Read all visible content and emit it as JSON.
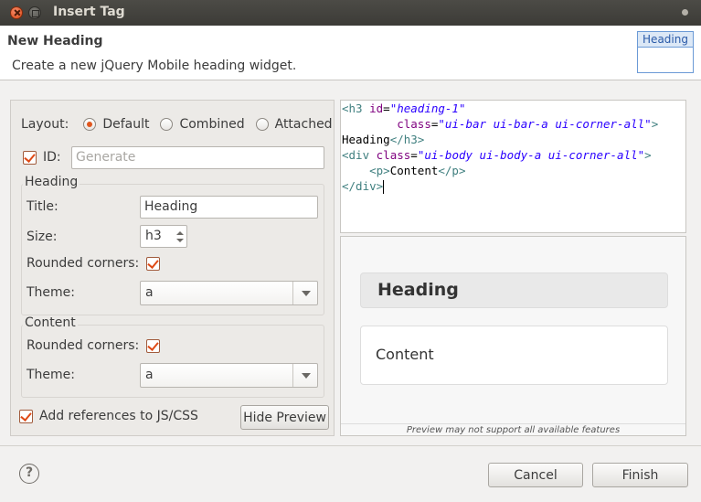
{
  "window": {
    "title": "Insert Tag"
  },
  "header": {
    "title": "New Heading",
    "description": "Create a new jQuery Mobile heading widget.",
    "badge": "Heading"
  },
  "form": {
    "layout_label": "Layout:",
    "layout_options": [
      "Default",
      "Combined",
      "Attached"
    ],
    "layout_selected": "Default",
    "id_label": "ID:",
    "id_checked": true,
    "id_placeholder": "Generate",
    "heading_group": {
      "label": "Heading",
      "title_label": "Title:",
      "title_value": "Heading",
      "size_label": "Size:",
      "size_value": "h3",
      "rounded_label": "Rounded corners:",
      "rounded_checked": true,
      "theme_label": "Theme:",
      "theme_value": "a"
    },
    "content_group": {
      "label": "Content",
      "rounded_label": "Rounded corners:",
      "rounded_checked": true,
      "theme_label": "Theme:",
      "theme_value": "a"
    },
    "add_refs_label": "Add references to JS/CSS",
    "add_refs_checked": true,
    "hide_preview_label": "Hide Preview"
  },
  "code": {
    "l1_open": "<h3",
    "l1_attr": "id",
    "l1_eq": "=",
    "l1_val": "\"heading-1\"",
    "l2_attr": "class",
    "l2_eq": "=",
    "l2_val": "\"ui-bar ui-bar-a ui-corner-all\"",
    "l2_close": ">",
    "l3_text": "Heading",
    "l3_close": "</h3>",
    "l4_open": "<div",
    "l4_attr": "class",
    "l4_eq": "=",
    "l4_val": "\"ui-body ui-body-a ui-corner-all\"",
    "l4_close": ">",
    "l5_open": "<p>",
    "l5_text": "Content",
    "l5_close": "</p>",
    "l6_close": "</div>"
  },
  "preview": {
    "heading": "Heading",
    "content": "Content",
    "note": "Preview may not support all available features"
  },
  "footer": {
    "help": "?",
    "cancel": "Cancel",
    "finish": "Finish"
  },
  "colors": {
    "accent": "#df4a16",
    "titlebar": "#3c3b37",
    "dialog_bg": "#f2f1f0"
  }
}
